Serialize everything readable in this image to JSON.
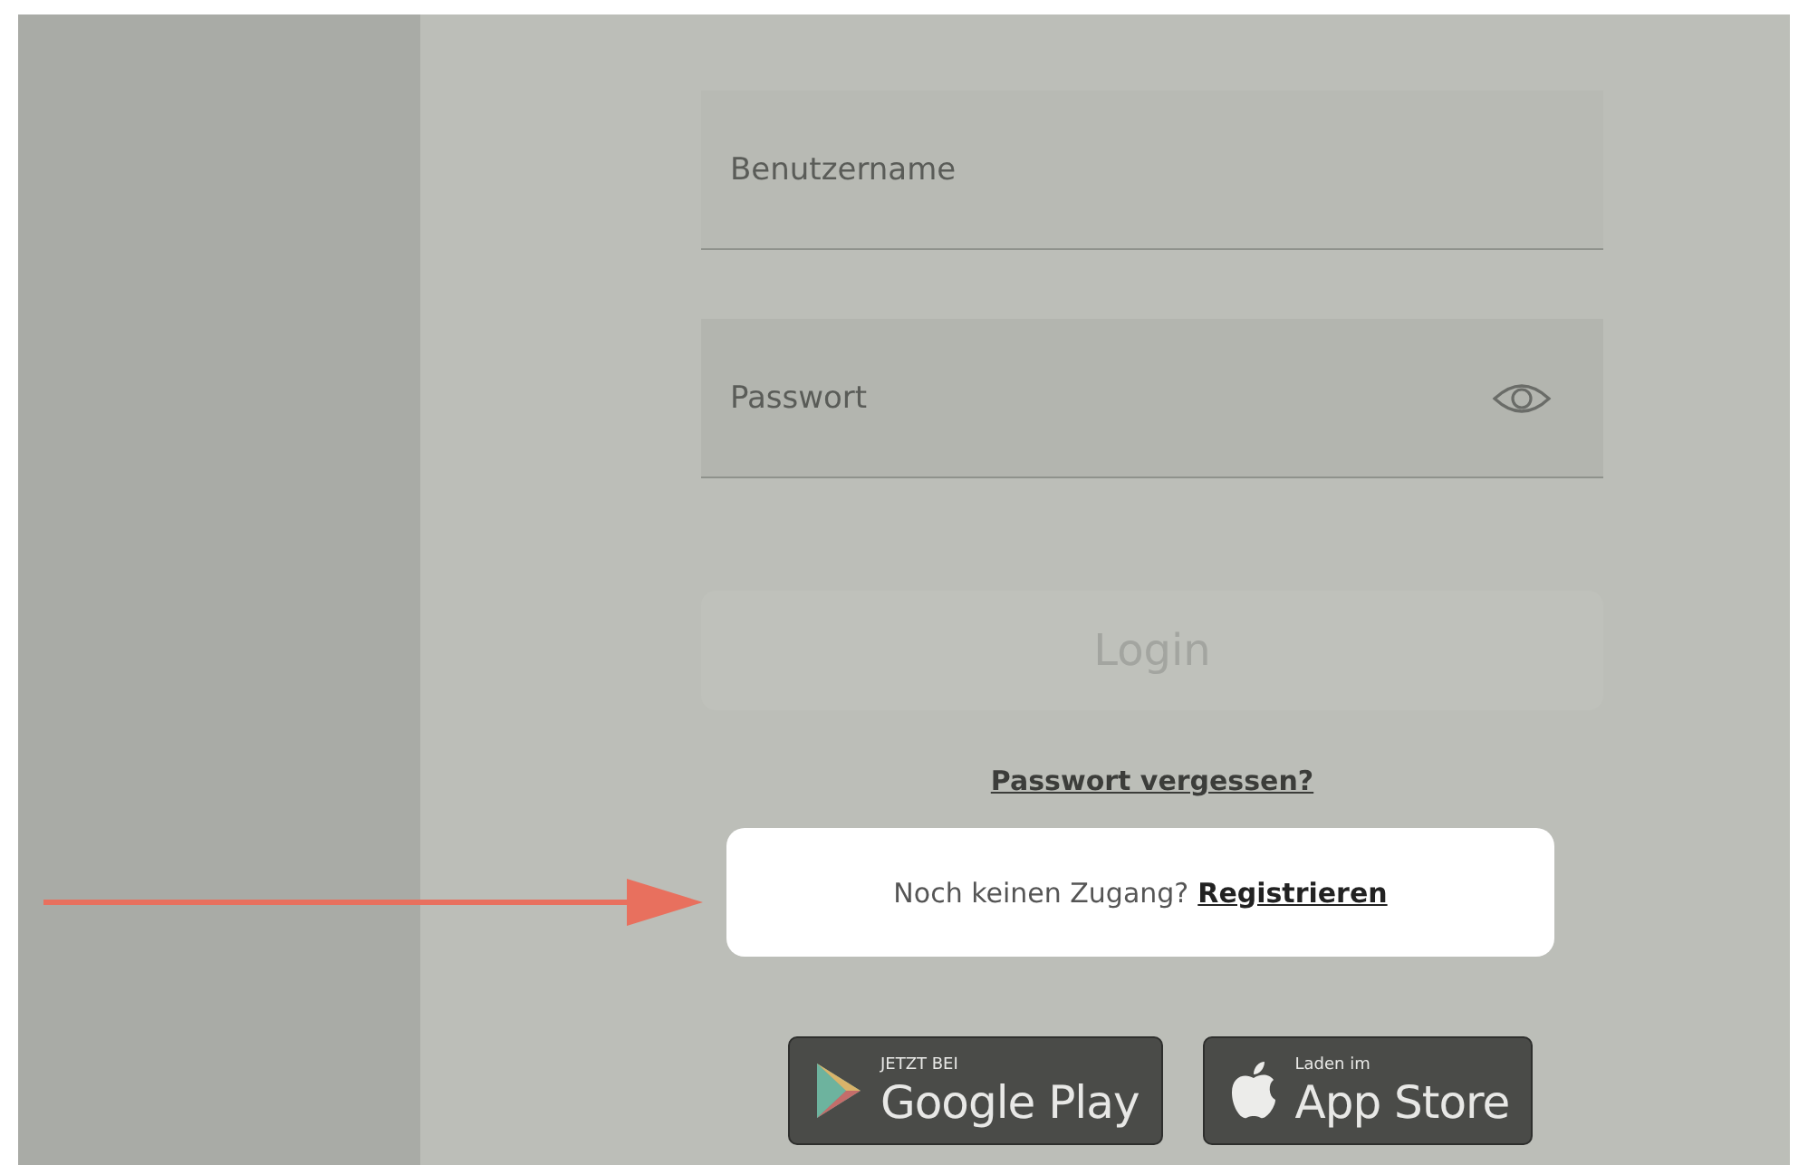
{
  "fields": [
    {
      "kind": "text",
      "placeholder": "Benutzername"
    },
    {
      "kind": "password",
      "placeholder": "Passwort"
    }
  ],
  "login_button": {
    "label": "Login",
    "disabled": true
  },
  "forgot_link": "Passwort vergessen?",
  "register_prompt": {
    "text": "Noch keinen Zugang?",
    "link": "Registrieren",
    "highlighted": true
  },
  "annotation_arrow": true,
  "store_badges": [
    {
      "kind": "google",
      "small": "JETZT BEI",
      "big": "Google Play"
    },
    {
      "kind": "apple",
      "small": "Laden im",
      "big": "App Store"
    }
  ]
}
